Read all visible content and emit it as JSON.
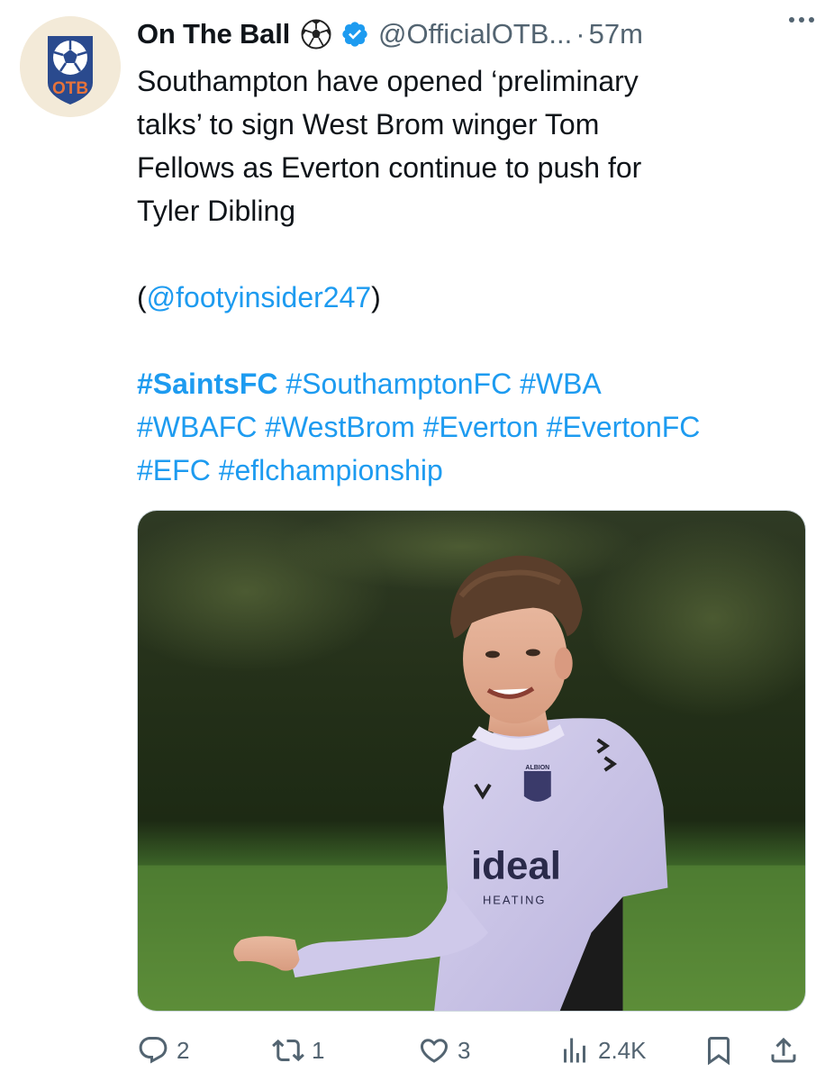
{
  "tweet": {
    "author": {
      "display_name": "On The Ball",
      "handle": "@OfficialOTB...",
      "timestamp": "57m",
      "dot": "·",
      "avatar_text": "OTB"
    },
    "text_lines": [
      "Southampton have opened ‘preliminary",
      "talks’ to sign West Brom winger Tom",
      "Fellows as Everton continue to push for",
      "Tyler Dibling"
    ],
    "source_open": "(",
    "source_mention": "@footyinsider247",
    "source_close": ")",
    "hashtags": {
      "line1": [
        "#SaintsFC",
        "#SouthamptonFC",
        "#WBA"
      ],
      "line2": [
        "#WBAFC",
        "#WestBrom",
        "#Everton",
        "#EvertonFC"
      ],
      "line3": [
        "#EFC",
        "#eflchampionship"
      ]
    },
    "media": {
      "shirt_text_main": "ideal",
      "shirt_text_sub": "HEATING",
      "badge_text": "ALBION"
    },
    "metrics": {
      "replies": "2",
      "reposts": "1",
      "likes": "3",
      "views": "2.4K"
    }
  },
  "icons": [
    "more-icon",
    "soccer-ball-icon",
    "verified-badge-icon",
    "reply-icon",
    "repost-icon",
    "like-icon",
    "views-icon",
    "bookmark-icon",
    "share-icon"
  ],
  "colors": {
    "link": "#1d9bf0",
    "secondary_text": "#536471",
    "primary_text": "#0f1419",
    "verified": "#1d9bf0",
    "avatar_bg": "#f3ead8",
    "avatar_blue": "#2a4a8e",
    "avatar_orange": "#e8733a"
  }
}
